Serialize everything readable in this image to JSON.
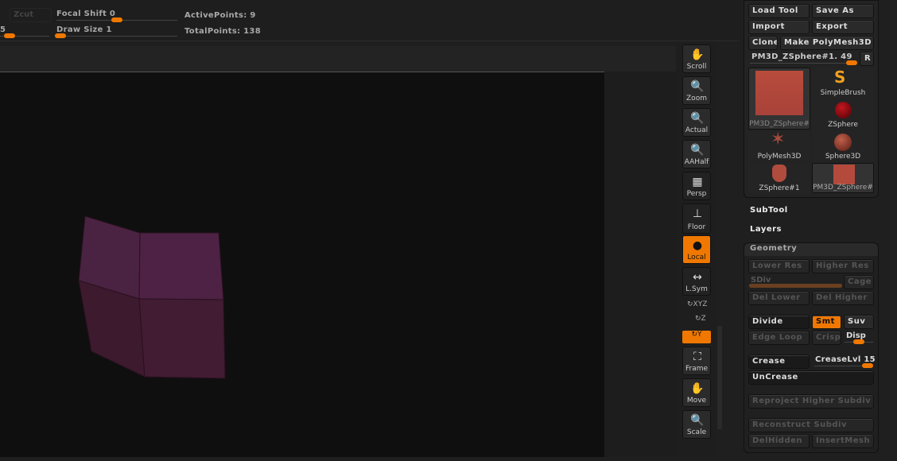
{
  "top": {
    "zcut": "Zcut",
    "focal_shift_label": "Focal Shift",
    "focal_shift_value": "0",
    "draw_size_label": "Draw Size",
    "draw_size_value": "1",
    "left_value": "5",
    "active_points": "ActivePoints: 9",
    "total_points": "TotalPoints: 138"
  },
  "shelf": [
    {
      "label": "Scroll",
      "icon": "hand-icon"
    },
    {
      "label": "Zoom",
      "icon": "magnifier-icon"
    },
    {
      "label": "Actual",
      "icon": "magnifier-x1-icon"
    },
    {
      "label": "AAHalf",
      "icon": "magnifier-half-icon"
    },
    {
      "label": "Persp",
      "icon": "grid-icon"
    },
    {
      "label": "Floor",
      "icon": "floor-icon"
    },
    {
      "label": "Local",
      "icon": "local-icon"
    },
    {
      "label": "L.Sym",
      "icon": "symmetry-icon"
    },
    {
      "label": "XYZ"
    },
    {
      "label": "Z"
    },
    {
      "label": "Y"
    },
    {
      "label": "Frame",
      "icon": "frame-icon"
    },
    {
      "label": "Move",
      "icon": "move-icon"
    },
    {
      "label": "Scale",
      "icon": "scale-icon"
    }
  ],
  "tool": {
    "load": "Load Tool",
    "save": "Save As",
    "import": "Import",
    "export": "Export",
    "clone": "Clone",
    "make": "Make PolyMesh3D",
    "name": "PM3D_ZSphere#1. 49",
    "r": "R",
    "tiles": [
      "PM3D_ZSphere#",
      "SimpleBrush",
      "ZSphere",
      "PolyMesh3D",
      "Sphere3D",
      "ZSphere#1",
      "PM3D_ZSphere#"
    ]
  },
  "subtool": "SubTool",
  "layers": "Layers",
  "geometry": {
    "title": "Geometry",
    "lower": "Lower Res",
    "higher": "Higher Res",
    "sdiv": "SDiv",
    "cage": "Cage",
    "del_lower": "Del Lower",
    "del_higher": "Del Higher",
    "divide": "Divide",
    "smt": "Smt",
    "suv": "Suv",
    "edge_loop": "Edge Loop",
    "crisp": "Crisp",
    "disp": "Disp",
    "crease": "Crease",
    "crease_lvl": "CreaseLvl 15",
    "uncrease": "UnCrease",
    "reproject": "Reproject Higher Subdiv",
    "reconstruct": "Reconstruct Subdiv",
    "delhidden": "DelHidden",
    "insertmesh": "InsertMesh"
  },
  "colors": {
    "accent": "#f07800",
    "mesh": "#4a2240"
  }
}
